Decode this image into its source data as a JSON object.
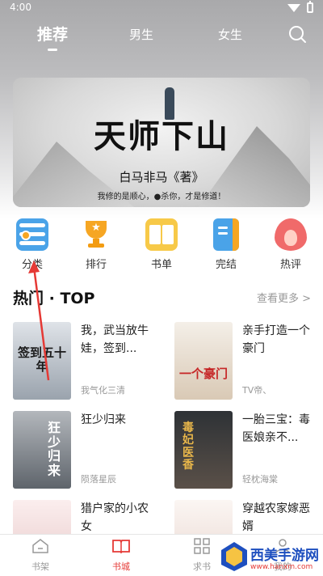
{
  "status": {
    "time": "4:00"
  },
  "top_tabs": [
    {
      "label": "推荐",
      "active": true
    },
    {
      "label": "男生",
      "active": false
    },
    {
      "label": "女生",
      "active": false
    }
  ],
  "banner": {
    "title": "天师下山",
    "author": "白马非马《著》",
    "tagline": "我修的是顺心，●杀你，才是修道！"
  },
  "categories": [
    {
      "label": "分类",
      "icon": "classify-icon"
    },
    {
      "label": "排行",
      "icon": "trophy-icon"
    },
    {
      "label": "书单",
      "icon": "open-book-icon"
    },
    {
      "label": "完结",
      "icon": "closed-book-icon"
    },
    {
      "label": "热评",
      "icon": "flame-icon"
    }
  ],
  "hot_section": {
    "title": "热门 · TOP",
    "see_more": "查看更多 >"
  },
  "books": [
    {
      "title": "我，武当放牛娃，签到...",
      "author": "我气化三清",
      "cover_text": "签到五十年",
      "cover_color": "#c9cfd6"
    },
    {
      "title": "亲手打造一个豪门",
      "author": "TV帝、",
      "cover_text": "一个豪门",
      "cover_color": "#e9e1d6"
    },
    {
      "title": "狂少归来",
      "author": "陨落星辰",
      "cover_text": "狂少归来",
      "cover_color": "#8a8f96"
    },
    {
      "title": "一胎三宝：毒医娘亲不...",
      "author": "轻枕海棠",
      "cover_text": "毒妃医香",
      "cover_color": "#3a3f44"
    },
    {
      "title": "猎户家的小农女",
      "author": "",
      "cover_text": "",
      "cover_color": "#f3e2e2"
    },
    {
      "title": "穿越农家嫁恶婿",
      "author": "",
      "cover_text": "",
      "cover_color": "#f4ece8"
    }
  ],
  "bottom_nav": [
    {
      "label": "书架",
      "active": false
    },
    {
      "label": "书城",
      "active": true
    },
    {
      "label": "求书",
      "active": false
    },
    {
      "label": "我的",
      "active": false
    }
  ],
  "watermark": {
    "text": "西美手游网",
    "url": "www.hanxm.com"
  },
  "colors": {
    "accent": "#e53935",
    "classify": "#4aa3e8",
    "gold": "#f6a623"
  }
}
